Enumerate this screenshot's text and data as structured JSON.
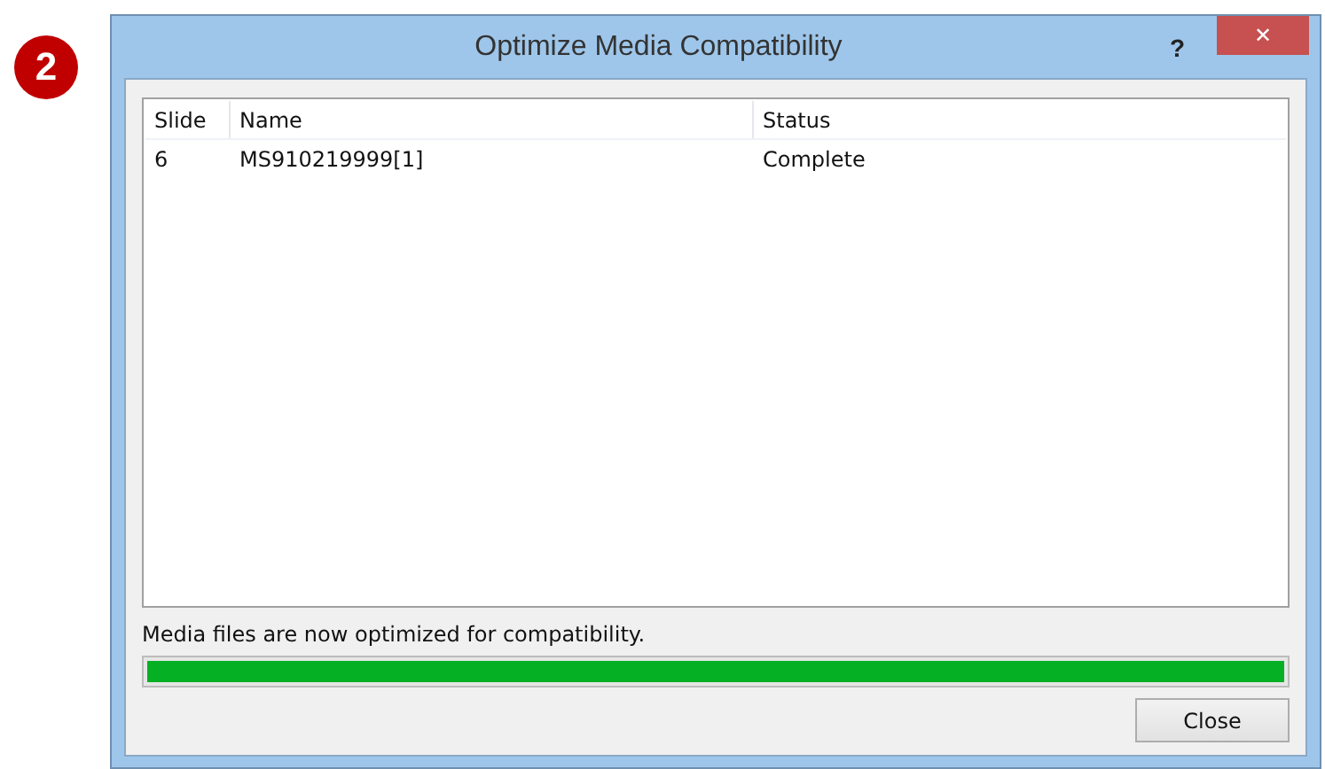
{
  "step_badge": "2",
  "window": {
    "title": "Optimize Media Compatibility",
    "help": "?",
    "close": "✕"
  },
  "table": {
    "columns": [
      "Slide",
      "Name",
      "Status"
    ],
    "rows": [
      [
        "6",
        "MS910219999[1]",
        "Complete"
      ]
    ]
  },
  "message": "Media files are now optimized for compatibility.",
  "progress": {
    "level": 1
  },
  "buttons": [
    "Close"
  ]
}
